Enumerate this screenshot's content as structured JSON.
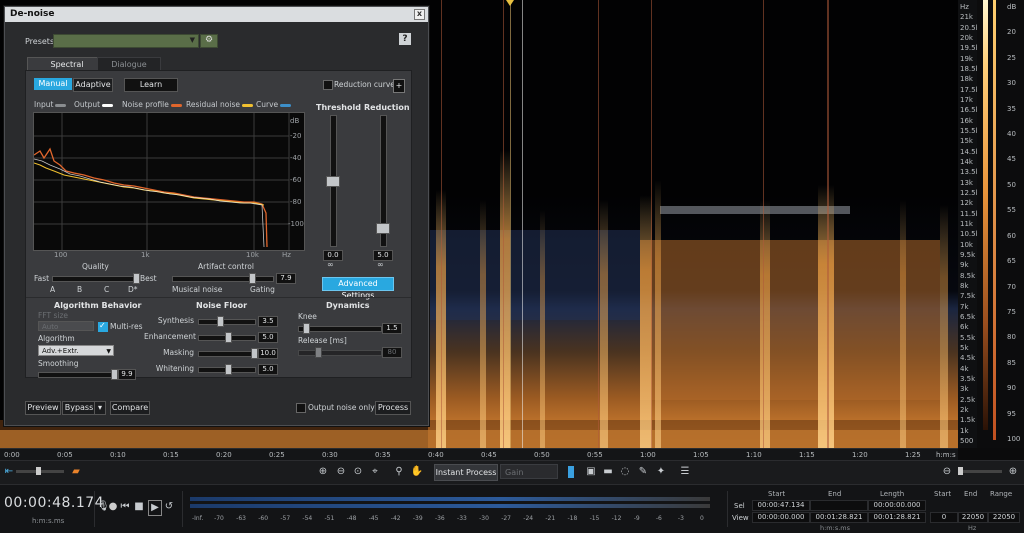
{
  "dialog": {
    "title": "De-noise",
    "close": "x",
    "presets_label": "Presets",
    "help_label": "?",
    "tabs": [
      "Spectral",
      "Dialogue"
    ],
    "mode_buttons": [
      "Manual",
      "Adaptive"
    ],
    "learn_label": "Learn",
    "reduction_curve_label": "Reduction curve",
    "plus_label": "+",
    "legend": [
      {
        "label": "Input",
        "color": "#8a8d90"
      },
      {
        "label": "Output",
        "color": "#ffffff"
      },
      {
        "label": "Noise profile",
        "color": "#e0662c"
      },
      {
        "label": "Residual noise",
        "color": "#f0c030"
      },
      {
        "label": "Curve",
        "color": "#3d8fc9"
      }
    ],
    "graph": {
      "db_label": "dB",
      "db_ticks": [
        "-20",
        "-40",
        "-60",
        "-80",
        "-100"
      ],
      "freq_ticks": [
        "100",
        "1k",
        "10k",
        "Hz"
      ]
    },
    "threshold": {
      "label": "Threshold",
      "value": "0.0",
      "link": "∞"
    },
    "reduction": {
      "label": "Reduction",
      "value": "5.0",
      "link": "∞"
    },
    "quality": {
      "label": "Quality",
      "left": "Fast",
      "right": "Best",
      "ticks": [
        "A",
        "B",
        "C",
        "D*"
      ]
    },
    "artifact": {
      "label": "Artifact control",
      "value": "7.9",
      "left": "Musical noise",
      "right": "Gating"
    },
    "advanced_label": "Advanced Settings",
    "algo": {
      "header": "Algorithm Behavior",
      "fft_label": "FFT size",
      "fft_value": "Auto",
      "multires_label": "Multi-res",
      "algorithm_label": "Algorithm",
      "algorithm_value": "Adv.+Extr.",
      "smoothing_label": "Smoothing",
      "smoothing_value": "9.9"
    },
    "noise_floor": {
      "header": "Noise Floor",
      "rows": [
        {
          "label": "Synthesis",
          "value": "3.5",
          "pos": 0.35
        },
        {
          "label": "Enhancement",
          "value": "5.0",
          "pos": 0.5
        },
        {
          "label": "Masking",
          "value": "10.0",
          "pos": 1.0
        },
        {
          "label": "Whitening",
          "value": "5.0",
          "pos": 0.5
        }
      ]
    },
    "dynamics": {
      "header": "Dynamics",
      "knee_label": "Knee",
      "knee_value": "1.5",
      "release_label": "Release [ms]",
      "release_value": "80"
    },
    "footer": {
      "preview": "Preview",
      "bypass": "Bypass",
      "bypass_menu": "▾",
      "compare": "Compare",
      "output_noise_only": "Output noise only",
      "process": "Process"
    }
  },
  "spectrogram": {
    "freq_labels": [
      "Hz",
      "21k",
      "20.5k",
      "20k",
      "19.5k",
      "19k",
      "18.5k",
      "18k",
      "17.5k",
      "17k",
      "16.5k",
      "16k",
      "15.5k",
      "15k",
      "14.5k",
      "14k",
      "13.5k",
      "13k",
      "12.5k",
      "12k",
      "11.5k",
      "11k",
      "10.5k",
      "10k",
      "9.5k",
      "9k",
      "8.5k",
      "8k",
      "7.5k",
      "7k",
      "6.5k",
      "6k",
      "5.5k",
      "5k",
      "4.5k",
      "4k",
      "3.5k",
      "3k",
      "2.5k",
      "2k",
      "1.5k",
      "1k",
      "500"
    ],
    "db_labels": [
      "dB",
      "20",
      "25",
      "30",
      "35",
      "40",
      "45",
      "50",
      "55",
      "60",
      "65",
      "70",
      "75",
      "80",
      "85",
      "90",
      "95",
      "100"
    ],
    "time_labels": [
      "0:00",
      "0:05",
      "0:10",
      "0:15",
      "0:20",
      "0:25",
      "0:30",
      "0:35",
      "0:40",
      "0:45",
      "0:50",
      "0:55",
      "1:00",
      "1:05",
      "1:10",
      "1:15",
      "1:20",
      "1:25",
      "h:m:s"
    ]
  },
  "toolbar": {
    "instant_process": "Instant Process",
    "gain_placeholder": "Gain"
  },
  "status": {
    "time": "00:00:48.174",
    "time_format": "h:m:s.ms",
    "meter_labels": [
      "-Inf.",
      "-70",
      "-63",
      "-60",
      "-57",
      "-54",
      "-51",
      "-48",
      "-45",
      "-42",
      "-39",
      "-36",
      "-33",
      "-30",
      "-27",
      "-24",
      "-21",
      "-18",
      "-15",
      "-12",
      "-9",
      "-6",
      "-3",
      "0"
    ],
    "sel_label": "Sel",
    "view_label": "View",
    "start_header": "Start",
    "end_header": "End",
    "length_header": "Length",
    "sel_start": "00:00:47.134",
    "sel_end": "",
    "sel_length": "00:00:00.000",
    "view_start": "00:00:00.000",
    "view_end": "00:01:28.821",
    "view_length": "00:01:28.821",
    "hms_label": "h:m:s.ms",
    "freq_start_header": "Start",
    "freq_end_header": "End",
    "freq_range_header": "Range",
    "freq_start": "0",
    "freq_end": "22050",
    "freq_range": "22050",
    "hz_label": "Hz"
  }
}
